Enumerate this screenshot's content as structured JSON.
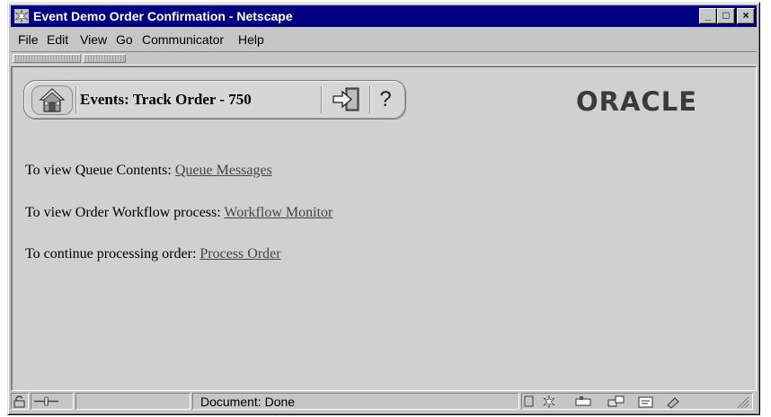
{
  "window": {
    "title": "Event Demo Order Confirmation - Netscape",
    "controls": [
      "_",
      "□",
      "×"
    ]
  },
  "menu": {
    "items": [
      "File",
      "Edit",
      "View",
      "Go",
      "Communicator",
      "Help"
    ]
  },
  "header": {
    "title": "Events: Track Order - 750",
    "help_glyph": "?",
    "logo_text": "ORACLE"
  },
  "content": {
    "lines": [
      {
        "prefix": "To view Queue Contents: ",
        "link": "Queue Messages"
      },
      {
        "prefix": "To view Order Workflow process: ",
        "link": "Workflow Monitor"
      },
      {
        "prefix": "To continue processing order: ",
        "link": "Process Order"
      }
    ]
  },
  "status": {
    "text": "Document: Done"
  },
  "colors": {
    "titlebar": "#000080",
    "content_bg": "#d0d0d0",
    "link": "#444444"
  },
  "icons": [
    "netscape-icon",
    "home-icon",
    "exit-icon",
    "help-icon",
    "security-icon",
    "connection-icon",
    "component-icons"
  ]
}
